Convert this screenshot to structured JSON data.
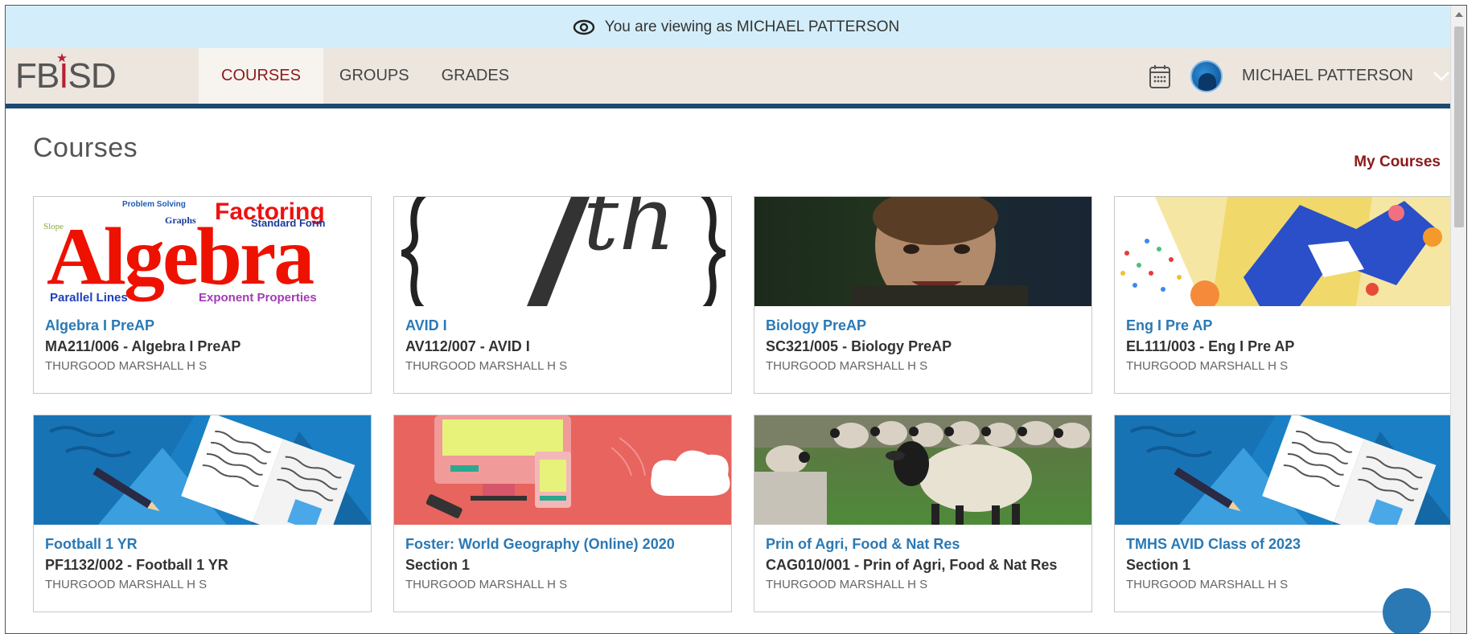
{
  "banner": {
    "text": "You are viewing as MICHAEL PATTERSON"
  },
  "logo": {
    "left": "FB",
    "star": "I",
    "right": "SD"
  },
  "nav": {
    "links": [
      {
        "label": "COURSES",
        "active": true
      },
      {
        "label": "GROUPS",
        "active": false
      },
      {
        "label": "GRADES",
        "active": false
      }
    ],
    "user_name": "MICHAEL PATTERSON"
  },
  "page": {
    "title": "Courses",
    "my_courses_link": "My Courses"
  },
  "courses": [
    {
      "title": "Algebra I PreAP",
      "code": "MA211/006 - Algebra I PreAP",
      "school": "THURGOOD MARSHALL H S",
      "image": "algebra-wordcloud",
      "image_text": {
        "main": "Algebra",
        "factoring": "Factoring",
        "standard_form": "Standard Form",
        "problem_solving": "Problem Solving",
        "graphs": "Graphs",
        "slope": "Slope",
        "parallel_lines": "Parallel Lines",
        "exponent_properties": "Exponent Properties"
      }
    },
    {
      "title": "AVID I",
      "code": "AV112/007 - AVID I",
      "school": "THURGOOD MARSHALL H S",
      "image": "avid-logo",
      "image_text": {
        "main": "{ /th }"
      }
    },
    {
      "title": "Biology PreAP",
      "code": "SC321/005 - Biology PreAP",
      "school": "THURGOOD MARSHALL H S",
      "image": "photo-face"
    },
    {
      "title": "Eng I Pre AP",
      "code": "EL111/003 - Eng I Pre AP",
      "school": "THURGOOD MARSHALL H S",
      "image": "colorful-abstract"
    },
    {
      "title": "Football 1 YR",
      "code": "PF1132/002 - Football 1 YR",
      "school": "THURGOOD MARSHALL H S",
      "image": "notebook-blue"
    },
    {
      "title": "Foster: World Geography (Online) 2020",
      "code": "Section 1",
      "school": "THURGOOD MARSHALL H S",
      "image": "devices-red"
    },
    {
      "title": "Prin of Agri, Food & Nat Res",
      "code": "CAG010/001 - Prin of Agri, Food & Nat Res",
      "school": "THURGOOD MARSHALL H S",
      "image": "sheep-photo"
    },
    {
      "title": "TMHS AVID Class of 2023",
      "code": "Section 1",
      "school": "THURGOOD MARSHALL H S",
      "image": "notebook-blue"
    }
  ],
  "colors": {
    "accent": "#8b1a1a",
    "link": "#2a79b5",
    "nav_border": "#1c4a70",
    "banner_bg": "#d3eefa"
  }
}
